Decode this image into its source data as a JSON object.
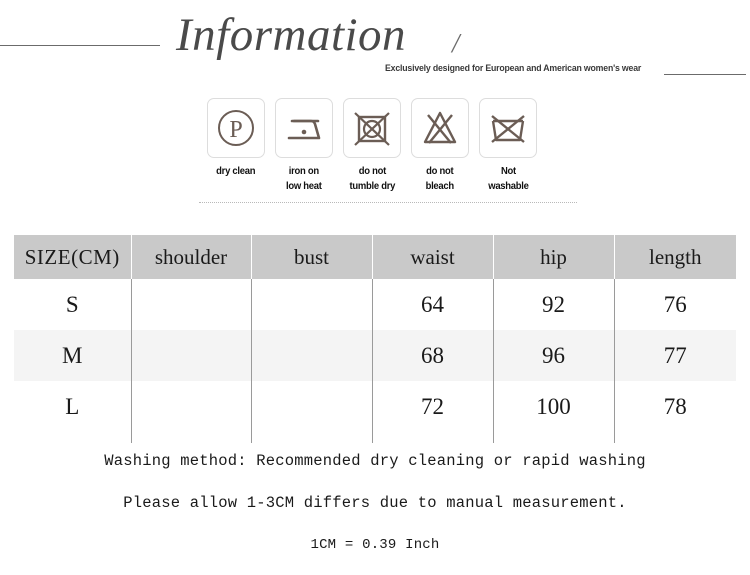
{
  "header": {
    "title": "Information",
    "slash": "/",
    "subtitle": "Exclusively designed for European and American women's wear"
  },
  "care_symbols": [
    {
      "icon": "dry-clean-p-circle-icon",
      "label": "dry clean"
    },
    {
      "icon": "iron-low-heat-one-dot-icon",
      "label": "iron on\nlow heat"
    },
    {
      "icon": "do-not-tumble-dry-icon",
      "label": "do not\ntumble dry"
    },
    {
      "icon": "do-not-bleach-icon",
      "label": "do not\nbleach"
    },
    {
      "icon": "not-washable-icon",
      "label": "Not\nwashable"
    }
  ],
  "size_table": {
    "headers": [
      "SIZE(CM)",
      "shoulder",
      "bust",
      "waist",
      "hip",
      "length"
    ],
    "rows": [
      {
        "size": "S",
        "shoulder": "",
        "bust": "",
        "waist": "64",
        "hip": "92",
        "length": "76"
      },
      {
        "size": "M",
        "shoulder": "",
        "bust": "",
        "waist": "68",
        "hip": "96",
        "length": "77"
      },
      {
        "size": "L",
        "shoulder": "",
        "bust": "",
        "waist": "72",
        "hip": "100",
        "length": "78"
      }
    ]
  },
  "notes": {
    "washing_method": "Washing method: Recommended dry cleaning or rapid washing",
    "tolerance": "Please allow 1-3CM differs due to manual measurement.",
    "conversion": "1CM = 0.39 Inch"
  },
  "colors": {
    "header_band": "#c9c9c9",
    "alt_row": "#f4f4f4",
    "icon_stroke": "#6b5d55",
    "title_text": "#4a4a4a",
    "size_letter": "#6f6f6f"
  }
}
